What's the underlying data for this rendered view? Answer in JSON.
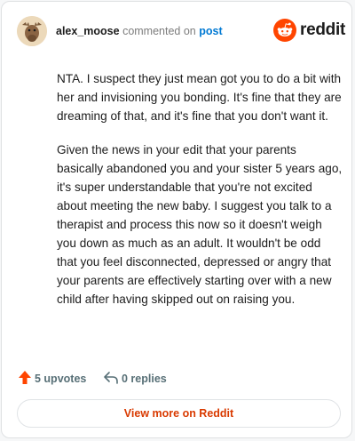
{
  "header": {
    "username": "alex_moose",
    "action_text": "commented on",
    "post_link": "post",
    "brand": "reddit"
  },
  "comment": {
    "paragraphs": [
      "NTA. I suspect they just mean got you to do a bit with her and invisioning you bonding. It's fine that they are dreaming of that, and it's fine that you don't want it.",
      "Given the news in your edit that your parents basically abandoned you and your sister 5 years ago, it's super understandable that you're not excited about meeting the new baby. I suggest you talk to a therapist and process this now so it doesn't weigh you down as much as an adult. It wouldn't be odd that you feel disconnected, depressed or angry that your parents are effectively starting over with a new child after having skipped out on raising you."
    ]
  },
  "actions": {
    "upvotes": "5 upvotes",
    "replies": "0 replies"
  },
  "view_more": "View more on Reddit",
  "colors": {
    "accent": "#ff4500",
    "link": "#0079d3",
    "view_more_text": "#d93a00"
  },
  "icons": {
    "avatar": "moose-avatar",
    "brand": "reddit-snoo-icon",
    "upvote": "upvote-arrow-icon",
    "reply": "reply-arrow-icon"
  }
}
